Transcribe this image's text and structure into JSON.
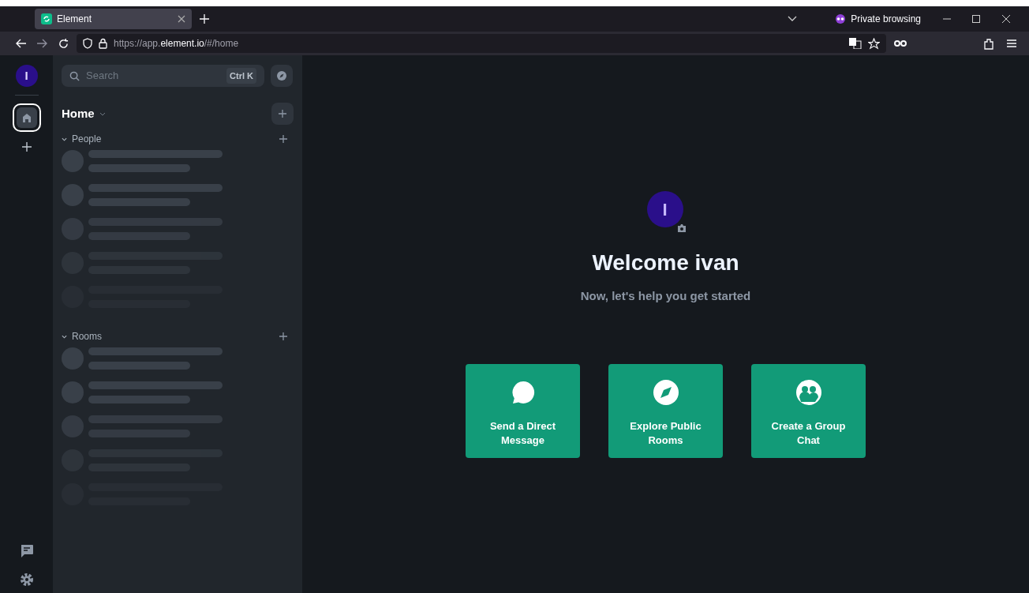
{
  "browser": {
    "tabs": [
      {
        "title": "Element",
        "selected": true
      }
    ],
    "private_label": "Private browsing",
    "url_prefix": "https://app.",
    "url_domain": "element.io",
    "url_suffix": "/#/home"
  },
  "space_bar": {
    "avatar_letter": "I",
    "items": [
      {
        "kind": "home",
        "selected": true
      },
      {
        "kind": "add",
        "selected": false
      }
    ]
  },
  "room_list": {
    "search": {
      "placeholder": "Search",
      "shortcut": "Ctrl K"
    },
    "title": "Home",
    "sections": [
      {
        "label": "People",
        "expanded": true
      },
      {
        "label": "Rooms",
        "expanded": true
      }
    ]
  },
  "main": {
    "avatar_letter": "I",
    "heading": "Welcome ivan",
    "subheading": "Now, let's help you get started",
    "actions": [
      {
        "kind": "message",
        "label": "Send a Direct Message"
      },
      {
        "kind": "explore",
        "label": "Explore Public Rooms"
      },
      {
        "kind": "group",
        "label": "Create a Group Chat"
      }
    ]
  }
}
